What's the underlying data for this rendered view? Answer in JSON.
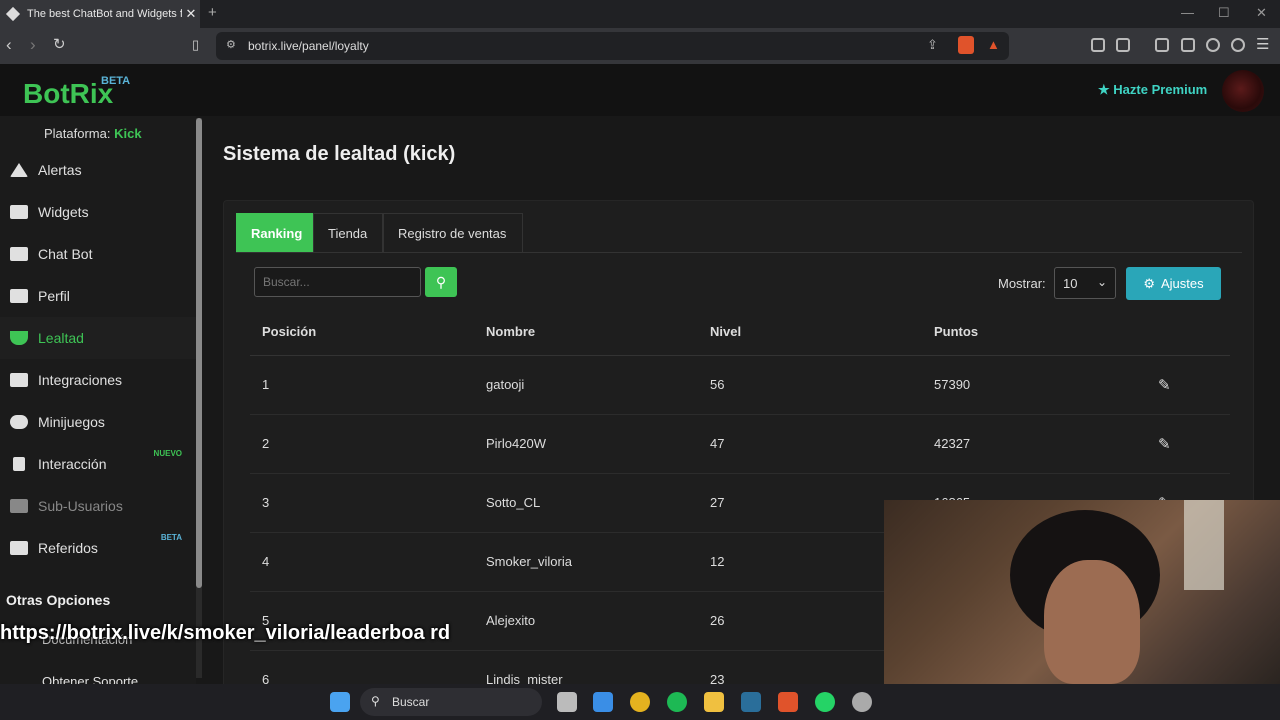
{
  "browser": {
    "tab_title": "The best ChatBot and Widgets f",
    "url": "botrix.live/panel/loyalty"
  },
  "header": {
    "logo": "BotRix",
    "logo_badge": "BETA",
    "premium_label": "Hazte Premium"
  },
  "sidebar": {
    "platform_label": "Plataforma:",
    "platform_value": "Kick",
    "items": [
      {
        "label": "Alertas",
        "icon": "warning-icon"
      },
      {
        "label": "Widgets",
        "icon": "grid-icon"
      },
      {
        "label": "Chat Bot",
        "icon": "robot-icon"
      },
      {
        "label": "Perfil",
        "icon": "id-card-icon"
      },
      {
        "label": "Lealtad",
        "icon": "trophy-icon"
      },
      {
        "label": "Integraciones",
        "icon": "plug-icon"
      },
      {
        "label": "Minijuegos",
        "icon": "gamepad-icon"
      },
      {
        "label": "Interacción",
        "icon": "music-icon",
        "badge": "NUEVO"
      },
      {
        "label": "Sub-Usuarios",
        "icon": "users-icon"
      },
      {
        "label": "Referidos",
        "icon": "people-icon",
        "badge": "BETA"
      }
    ],
    "section_title": "Otras Opciones",
    "extra_items": [
      {
        "label": "Documentación"
      },
      {
        "label": "Obtener Soporte"
      }
    ]
  },
  "main": {
    "title": "Sistema de lealtad (kick)",
    "tabs": [
      {
        "label": "Ranking"
      },
      {
        "label": "Tienda"
      },
      {
        "label": "Registro de ventas"
      }
    ],
    "search_placeholder": "Buscar...",
    "show_label": "Mostrar:",
    "show_value": "10",
    "settings_label": "Ajustes",
    "table": {
      "headers": [
        "Posición",
        "Nombre",
        "Nivel",
        "Puntos"
      ],
      "rows": [
        {
          "pos": "1",
          "name": "gatooji",
          "level": "56",
          "points": "57390"
        },
        {
          "pos": "2",
          "name": "Pirlo420W",
          "level": "47",
          "points": "42327"
        },
        {
          "pos": "3",
          "name": "Sotto_CL",
          "level": "27",
          "points": "16865"
        },
        {
          "pos": "4",
          "name": "Smoker_viloria",
          "level": "12",
          "points": ""
        },
        {
          "pos": "5",
          "name": "Alejexito",
          "level": "26",
          "points": ""
        },
        {
          "pos": "6",
          "name": "Lindis_mister",
          "level": "23",
          "points": ""
        }
      ]
    }
  },
  "overlay": {
    "url_text": "https://botrix.live/k/smoker_viloria/leaderboa rd"
  },
  "taskbar": {
    "search_label": "Buscar"
  },
  "colors": {
    "accent": "#3ec455",
    "info": "#2aa6b8",
    "premium": "#3fd4c4"
  }
}
